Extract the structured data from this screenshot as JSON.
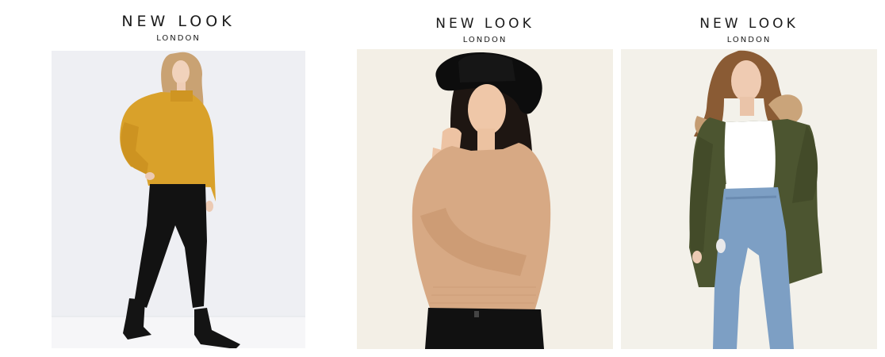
{
  "products": [
    {
      "brand": "NEW LOOK",
      "sub": "LONDON",
      "photo": {
        "background": "#eeeff3",
        "garment": "mustard-jumper",
        "garment_color": "#d9a12a",
        "bottoms_color": "#111111"
      }
    },
    {
      "brand": "NEW LOOK",
      "sub": "LONDON",
      "photo": {
        "background": "#f3efe6",
        "garment": "camel-knit-jumper",
        "garment_color": "#d7a984",
        "bottoms_color": "#111111",
        "hat_color": "#0d0d0d"
      }
    },
    {
      "brand": "NEW LOOK",
      "sub": "LONDON",
      "photo": {
        "background": "#f3f1ea",
        "garment": "khaki-parka",
        "garment_color": "#4c5530",
        "top_color": "#ffffff",
        "bottoms_color": "#7d9fc4"
      }
    }
  ]
}
